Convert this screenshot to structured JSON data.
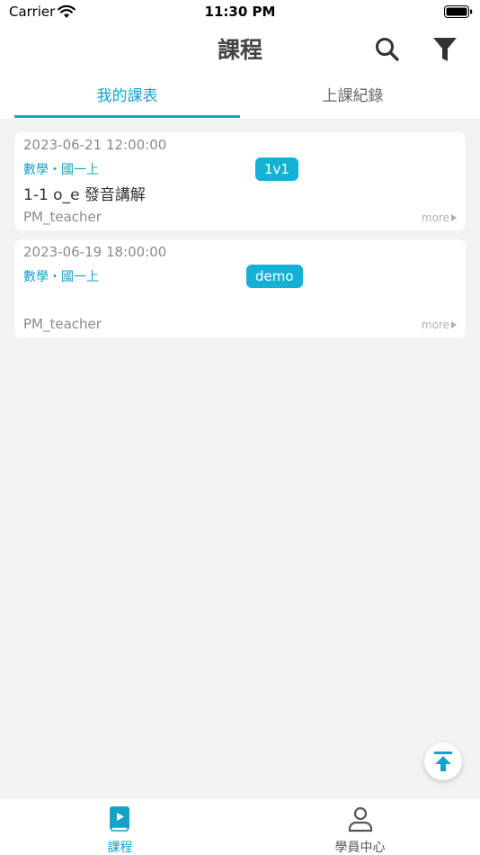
{
  "status_bar": {
    "carrier": "Carrier",
    "time": "11:30 PM"
  },
  "nav": {
    "title": "課程",
    "search_icon": "search-icon",
    "filter_icon": "filter-icon"
  },
  "tabs": [
    {
      "label": "我的課表",
      "active": true
    },
    {
      "label": "上課紀錄",
      "active": false
    }
  ],
  "courses": [
    {
      "datetime": "2023-06-21 12:00:00",
      "subject": "數學・國一上",
      "badge": "1v1",
      "lesson": "1-1 o_e 發音講解",
      "teacher": "PM_teacher",
      "more": "more"
    },
    {
      "datetime": "2023-06-19 18:00:00",
      "subject": "數學・國一上",
      "badge": "demo",
      "lesson": "",
      "teacher": "PM_teacher",
      "more": "more"
    }
  ],
  "bottom_tabs": [
    {
      "label": "課程",
      "icon": "book-icon",
      "active": true
    },
    {
      "label": "學員中心",
      "icon": "user-icon",
      "active": false
    }
  ],
  "colors": {
    "accent": "#14a3c8",
    "badge": "#14b1d4",
    "background": "#f2f2f2"
  }
}
